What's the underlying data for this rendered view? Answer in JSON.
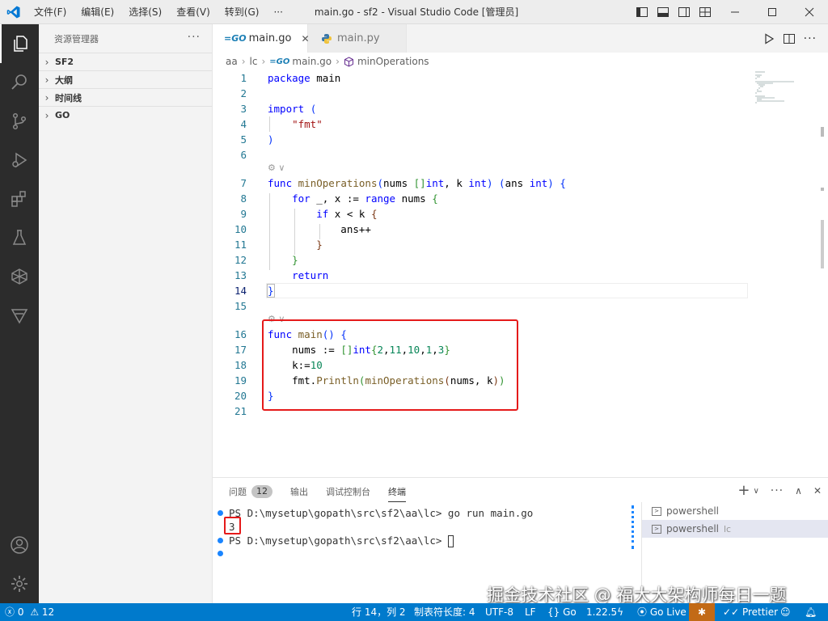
{
  "titlebar": {
    "menus": [
      "文件(F)",
      "编辑(E)",
      "选择(S)",
      "查看(V)",
      "转到(G)",
      "···"
    ],
    "title": "main.go - sf2 - Visual Studio Code [管理员]"
  },
  "sidebar": {
    "title": "资源管理器",
    "more": "···",
    "sections": [
      "SF2",
      "大纲",
      "时间线",
      "GO"
    ]
  },
  "tabs": [
    {
      "label": "main.go",
      "icon": "go-icon",
      "active": true
    },
    {
      "label": "main.py",
      "icon": "python-icon",
      "active": false
    }
  ],
  "breadcrumb": [
    "aa",
    "lc",
    "main.go",
    "minOperations"
  ],
  "editor": {
    "current_line": 14,
    "line_numbers": [
      "1",
      "2",
      "3",
      "4",
      "5",
      "6",
      "7",
      "8",
      "9",
      "10",
      "11",
      "12",
      "13",
      "14",
      "15",
      "16",
      "17",
      "18",
      "19",
      "20",
      "21"
    ],
    "codelens": [
      "⚙ ∨",
      "⚙ ∨"
    ]
  },
  "panel": {
    "tabs": [
      "问题",
      "输出",
      "调试控制台",
      "终端"
    ],
    "problems_count": "12",
    "terminal_lines": [
      "PS D:\\mysetup\\gopath\\src\\sf2\\aa\\lc> go run main.go",
      "3",
      "PS D:\\mysetup\\gopath\\src\\sf2\\aa\\lc> "
    ],
    "terminals": [
      {
        "label": "powershell",
        "sub": ""
      },
      {
        "label": "powershell",
        "sub": "lc"
      }
    ]
  },
  "statusbar": {
    "errors": "0",
    "warnings": "12",
    "position": "行 14，列 2",
    "tab_size": "制表符长度: 4",
    "encoding": "UTF-8",
    "eol": "LF",
    "language": "Go",
    "go_version": "1.22.5",
    "go_live": "Go Live",
    "prettier": "Prettier"
  },
  "watermark": "掘金技术社区 @ 福大大架构师每日一题",
  "colors": {
    "accent": "#007acc",
    "highlight_box": "#e51a1a",
    "activitybar": "#2c2c2c"
  }
}
